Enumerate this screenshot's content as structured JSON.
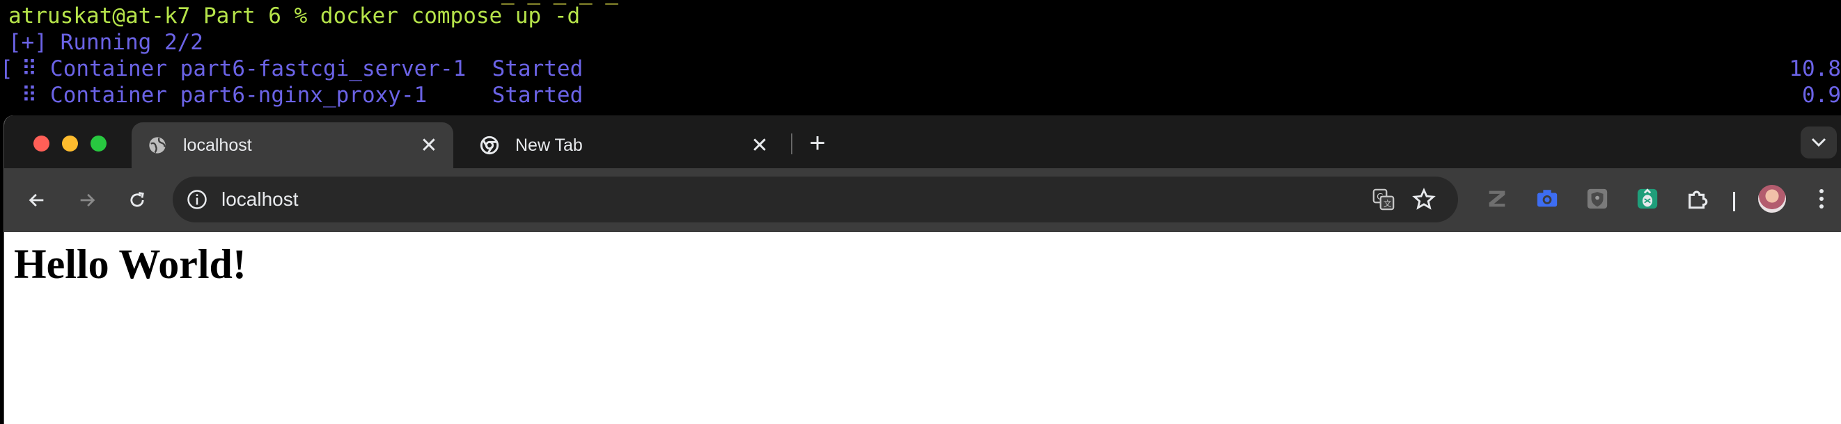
{
  "terminal": {
    "prompt_line": "atruskat@at-k7 Part 6 % docker compose up -d",
    "running_line": "[+] Running 2/2",
    "containers": [
      {
        "prefix": " ⠿ Container ",
        "name": "part6-fastcgi_server-1 ",
        "status": "Started",
        "time": "10.8"
      },
      {
        "prefix": " ⠿ Container ",
        "name": "part6-nginx_proxy-1    ",
        "status": "Started",
        "time": "0.9"
      }
    ],
    "left_bracket": "[",
    "peek_text": "_ _ _  _ _"
  },
  "browser": {
    "tabs": [
      {
        "label": "localhost",
        "favicon": "globe-icon",
        "active": true
      },
      {
        "label": "New Tab",
        "favicon": "chrome-icon",
        "active": false
      }
    ],
    "new_tab_label": "+",
    "close_label": "✕",
    "address": "localhost",
    "extensions": [
      "zotero-icon",
      "camera-icon",
      "shield-extension-icon",
      "pineapple-icon",
      "puzzle-icon"
    ]
  },
  "page": {
    "heading": "Hello World!"
  },
  "colors": {
    "terminal_green": "#b6e44a",
    "terminal_blue": "#6b63e6",
    "tab_active": "#3c3c3c"
  }
}
